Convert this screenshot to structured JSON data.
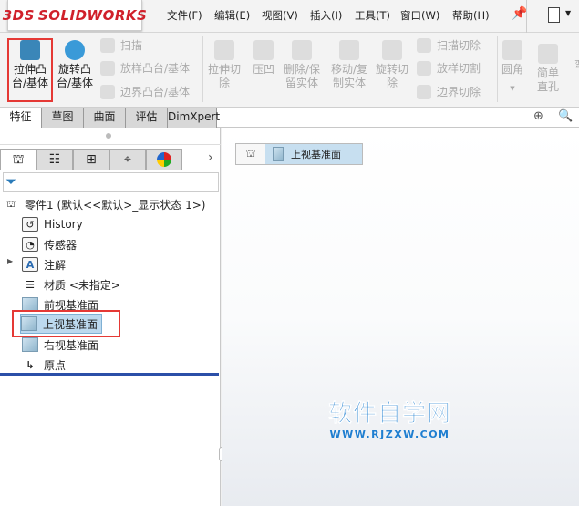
{
  "app": {
    "logo": "SOLIDWORKS",
    "logo_prefix": "3DS"
  },
  "menu": [
    "文件(F)",
    "编辑(E)",
    "视图(V)",
    "插入(I)",
    "工具(T)",
    "窗口(W)",
    "帮助(H)"
  ],
  "ribbon": {
    "extrude_boss": "拉伸凸台/基体",
    "revolve_boss": "旋转凸台/基体",
    "sweep": "扫描",
    "loft_boss": "放样凸台/基体",
    "boundary_boss": "边界凸台/基体",
    "extrude_cut": "拉伸切除",
    "indent": "压凹",
    "delete_keep_body": "删除/保留实体",
    "move_copy_body": "移动/复制实体",
    "revolve_cut": "旋转切除",
    "sweep_cut": "扫描切除",
    "loft_cut": "放样切割",
    "boundary_cut": "边界切除",
    "fillet": "圆角",
    "simple_hole": "简单直孔",
    "cut_off": "弯"
  },
  "tabs": [
    "特征",
    "草图",
    "曲面",
    "评估",
    "DimXpert"
  ],
  "tree": {
    "root": "零件1  (默认<<默认>_显示状态 1>)",
    "items": [
      "History",
      "传感器",
      "注解",
      "材质 <未指定>",
      "前视基准面",
      "上视基准面",
      "右视基准面",
      "原点"
    ]
  },
  "breadcrumb": {
    "selected": "上视基准面"
  },
  "watermark": {
    "title": "软件自学网",
    "url": "WWW.RJZXW.COM"
  }
}
